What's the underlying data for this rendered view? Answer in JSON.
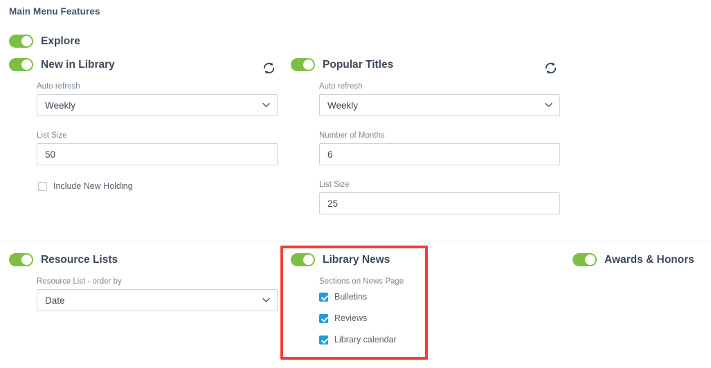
{
  "page": {
    "title": "Main Menu Features"
  },
  "icons": {
    "refresh": "refresh-icon",
    "chevron_down": "chevron-down-icon"
  },
  "colors": {
    "toggle_on": "#7dbf45",
    "checkbox_checked": "#1f9bde",
    "highlight_border": "#f73b36",
    "heading_text": "#42566b",
    "label_text": "#7b8794",
    "value_text": "#3c4858",
    "input_border": "#cfd4d9",
    "divider": "#e6e9ec"
  },
  "features": {
    "explore": {
      "label": "Explore",
      "toggle_state": "on"
    },
    "new_in_library": {
      "label": "New in Library",
      "toggle_state": "on",
      "refresh_action": "Refresh",
      "auto_refresh": {
        "label": "Auto refresh",
        "value": "Weekly",
        "options": [
          "Weekly"
        ]
      },
      "list_size": {
        "label": "List Size",
        "value": "50"
      },
      "include_new_holding": {
        "label": "Include New Holding",
        "checked": false
      }
    },
    "popular_titles": {
      "label": "Popular Titles",
      "toggle_state": "on",
      "refresh_action": "Refresh",
      "auto_refresh": {
        "label": "Auto refresh",
        "value": "Weekly",
        "options": [
          "Weekly"
        ]
      },
      "number_of_months": {
        "label": "Number of Months",
        "value": "6"
      },
      "list_size": {
        "label": "List Size",
        "value": "25"
      }
    },
    "resource_lists": {
      "label": "Resource Lists",
      "toggle_state": "on",
      "order_by": {
        "label": "Resource List - order by",
        "value": "Date",
        "options": [
          "Date"
        ]
      }
    },
    "library_news": {
      "label": "Library News",
      "toggle_state": "on",
      "highlighted": true,
      "sections": {
        "label": "Sections on News Page",
        "items": [
          {
            "label": "Bulletins",
            "checked": true
          },
          {
            "label": "Reviews",
            "checked": true
          },
          {
            "label": "Library calendar",
            "checked": true
          }
        ]
      }
    },
    "awards_honors": {
      "label": "Awards & Honors",
      "toggle_state": "on"
    }
  }
}
